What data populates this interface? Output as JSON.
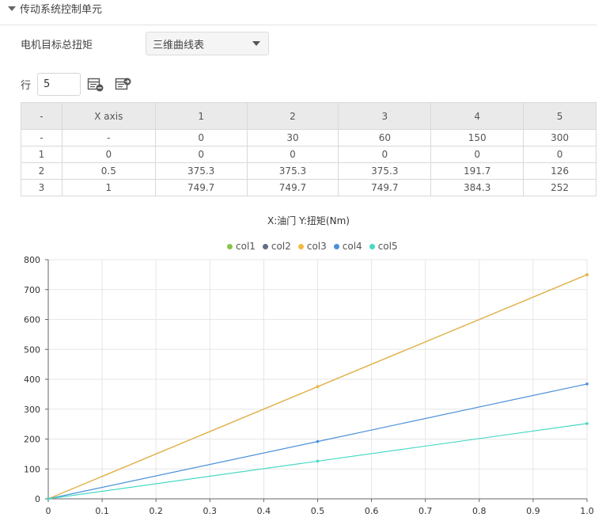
{
  "section": {
    "title": "传动系统控制单元",
    "caret_icon": "caret-down-icon"
  },
  "torque": {
    "label": "电机目标总扭矩",
    "select_value": "三维曲线表"
  },
  "rows": {
    "label": "行",
    "value": "5",
    "add_icon": "table-add-icon",
    "export_icon": "table-export-icon"
  },
  "table": {
    "headers": [
      "-",
      "X axis",
      "1",
      "2",
      "3",
      "4",
      "5"
    ],
    "rows": [
      [
        "-",
        "-",
        "0",
        "30",
        "60",
        "150",
        "300"
      ],
      [
        "1",
        "0",
        "0",
        "0",
        "0",
        "0",
        "0"
      ],
      [
        "2",
        "0.5",
        "375.3",
        "375.3",
        "375.3",
        "191.7",
        "126"
      ],
      [
        "3",
        "1",
        "749.7",
        "749.7",
        "749.7",
        "384.3",
        "252"
      ]
    ]
  },
  "chart_data": {
    "type": "line",
    "title": "X:油门 Y:扭矩(Nm)",
    "x": [
      0,
      0.5,
      1
    ],
    "series": [
      {
        "name": "col1",
        "color": "#8bc34a",
        "values": [
          0,
          375.3,
          749.7
        ]
      },
      {
        "name": "col2",
        "color": "#5f6f85",
        "values": [
          0,
          375.3,
          749.7
        ]
      },
      {
        "name": "col3",
        "color": "#f5b942",
        "values": [
          0,
          375.3,
          749.7
        ]
      },
      {
        "name": "col4",
        "color": "#4a90d9",
        "values": [
          0,
          191.7,
          384.3
        ]
      },
      {
        "name": "col5",
        "color": "#48d9c4",
        "values": [
          0,
          126,
          252
        ]
      }
    ],
    "xlim": [
      0,
      1
    ],
    "ylim": [
      0,
      800
    ],
    "xticks": [
      "0",
      "0.1",
      "0.2",
      "0.3",
      "0.4",
      "0.5",
      "0.6",
      "0.7",
      "0.8",
      "0.9",
      "1.0"
    ],
    "yticks": [
      "0",
      "100",
      "200",
      "300",
      "400",
      "500",
      "600",
      "700",
      "800"
    ],
    "grid": true,
    "legend_position": "top-center"
  }
}
